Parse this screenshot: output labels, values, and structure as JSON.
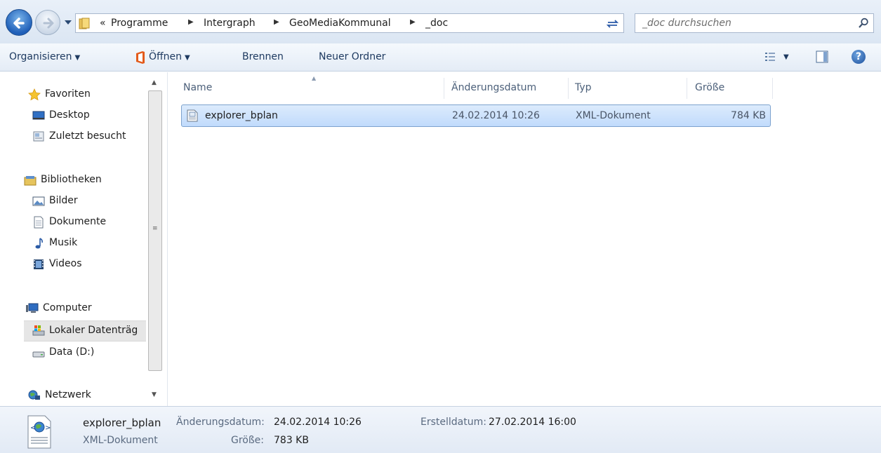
{
  "address": {
    "overflow": "«",
    "crumbs": [
      "Programme",
      "Intergraph",
      "GeoMediaKommunal",
      "_doc"
    ],
    "search_placeholder": "_doc durchsuchen"
  },
  "toolbar": {
    "organize": "Organisieren",
    "open": "Öffnen",
    "burn": "Brennen",
    "new_folder": "Neuer Ordner"
  },
  "navigation": {
    "favorites": {
      "label": "Favoriten",
      "items": [
        "Desktop",
        "Zuletzt besucht"
      ]
    },
    "libraries": {
      "label": "Bibliotheken",
      "items": [
        "Bilder",
        "Dokumente",
        "Musik",
        "Videos"
      ]
    },
    "computer": {
      "label": "Computer",
      "items": [
        "Lokaler Datenträg",
        "Data (D:)"
      ]
    },
    "network": {
      "label": "Netzwerk"
    }
  },
  "columns": {
    "name": "Name",
    "modified": "Änderungsdatum",
    "type": "Typ",
    "size": "Größe"
  },
  "files": [
    {
      "name": "explorer_bplan",
      "modified": "24.02.2014 10:26",
      "type": "XML-Dokument",
      "size": "784 KB"
    }
  ],
  "details": {
    "name": "explorer_bplan",
    "type": "XML-Dokument",
    "modified_label": "Änderungsdatum:",
    "modified_value": "24.02.2014 10:26",
    "size_label": "Größe:",
    "size_value": "783 KB",
    "created_label": "Erstelldatum:",
    "created_value": "27.02.2014 16:00"
  },
  "colors": {
    "selection": "#cce0fb",
    "selection_border": "#7da2ce",
    "chrome": "#dbe6f3"
  }
}
